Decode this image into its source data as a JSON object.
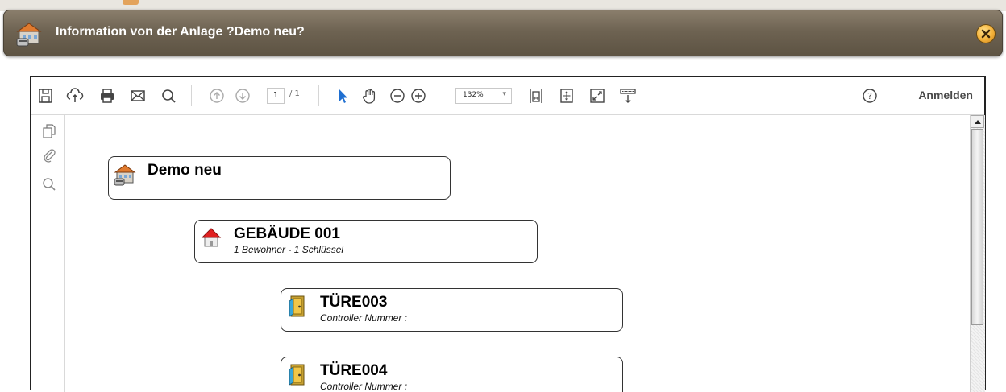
{
  "dialog": {
    "title": "Information von der Anlage ?Demo neu?",
    "close_icon": "close-icon",
    "accent_color": "#f4b23a"
  },
  "viewer": {
    "toolbar": {
      "page_current": "1",
      "page_total": "/ 1",
      "zoom": "132%",
      "signin_label": "Anmelden",
      "icons": [
        "save-icon",
        "upload-icon",
        "print-icon",
        "email-icon",
        "search-icon",
        "page-up-icon",
        "page-down-icon",
        "select-tool-icon",
        "hand-tool-icon",
        "zoom-out-icon",
        "zoom-in-icon",
        "fit-width-icon",
        "fit-page-icon",
        "fullscreen-icon",
        "read-mode-icon",
        "help-icon"
      ]
    },
    "leftrail": {
      "icons": [
        "pages-icon",
        "attachments-icon",
        "search-icon"
      ]
    }
  },
  "tree": {
    "root": {
      "title": "Demo neu",
      "icon": "facility-icon"
    },
    "building": {
      "title": "GEBÄUDE  001",
      "subtitle": "1 Bewohner - 1 Schlüssel",
      "icon": "building-icon"
    },
    "doors": [
      {
        "title": "TÜRE003",
        "subtitle": "Controller Nummer  :",
        "icon": "door-icon"
      },
      {
        "title": "TÜRE004",
        "subtitle": "Controller Nummer  :",
        "icon": "door-icon"
      }
    ]
  }
}
